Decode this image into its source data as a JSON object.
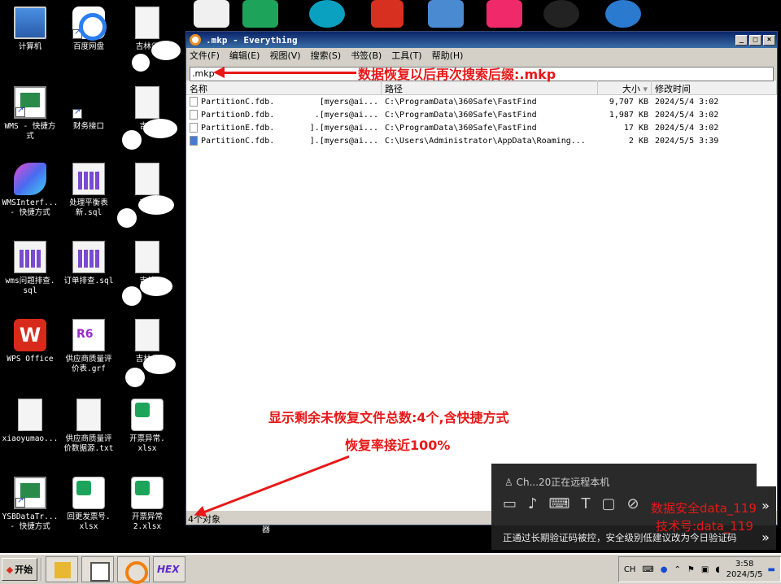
{
  "desktop": {
    "icons": [
      {
        "label": "计算机"
      },
      {
        "label": "百度网盘"
      },
      {
        "label": "吉林省"
      },
      {
        "label": "WMS - 快捷方\n式"
      },
      {
        "label": "财务接口"
      },
      {
        "label": "吉林"
      },
      {
        "label": "WMSInterf...\n- 快捷方式"
      },
      {
        "label": "处理平衡表\n新.sql"
      },
      {
        "label": "吉林"
      },
      {
        "label": "wms问题排查.\nsql"
      },
      {
        "label": "订单排查.sql"
      },
      {
        "label": "吉林"
      },
      {
        "label": "WPS Office"
      },
      {
        "label": "供应商质量评\n价表.grf"
      },
      {
        "label": "吉林省"
      },
      {
        "label": "xiaoyumao..."
      },
      {
        "label": "供应商质量评\n价数据源.txt"
      },
      {
        "label": "开票异常.\nxlsx"
      },
      {
        "label": "YSBDataTr...\n- 快捷方式"
      },
      {
        "label": "回更发票号.\nxlsx"
      },
      {
        "label": "开票异常\n2.xlsx"
      }
    ],
    "stray_label": "器"
  },
  "window": {
    "title": ".mkp  - Everything",
    "menu": [
      "文件(F)",
      "编辑(E)",
      "视图(V)",
      "搜索(S)",
      "书签(B)",
      "工具(T)",
      "帮助(H)"
    ],
    "search_value": ".mkp",
    "columns": {
      "name": "名称",
      "path": "路径",
      "size": "大小",
      "date": "修改时间"
    },
    "rows": [
      {
        "name": "PartitionC.fdb.",
        "mid": ".[myers@ai...",
        "path": "C:\\ProgramData\\360Safe\\FastFind",
        "size": "9,707 KB",
        "date": "2024/5/4 3:02"
      },
      {
        "name": "PartitionD.fdb.",
        "mid": ".[myers@ai...",
        "path": "C:\\ProgramData\\360Safe\\FastFind",
        "size": "1,987 KB",
        "date": "2024/5/4 3:02"
      },
      {
        "name": "PartitionE.fdb.",
        "mid": "].[myers@ai...",
        "path": "C:\\ProgramData\\360Safe\\FastFind",
        "size": "17 KB",
        "date": "2024/5/4 3:02"
      },
      {
        "name": "PartitionC.fdb.",
        "mid": "].[myers@ai...",
        "path": "C:\\Users\\Administrator\\AppData\\Roaming...",
        "size": "2 KB",
        "date": "2024/5/5 3:39"
      }
    ],
    "status": "4个对象"
  },
  "annotations": {
    "search_note": "数据恢复以后再次搜索后缀:.mkp",
    "count_note": "显示剩余未恢复文件总数:4个,含快捷方式",
    "rate_note": "恢复率接近100%"
  },
  "remote": {
    "header": "Ch...20正在远程本机",
    "notice": "正通过长期验证码被控，安全级别低建议改为今日验证码"
  },
  "watermark": {
    "line1": "数据安全data_119",
    "line2": "技术号:data_119"
  },
  "taskbar": {
    "start_label": "开始",
    "tray_lang": "CH",
    "clock_time": "3:58",
    "clock_date": "2024/5/5"
  }
}
